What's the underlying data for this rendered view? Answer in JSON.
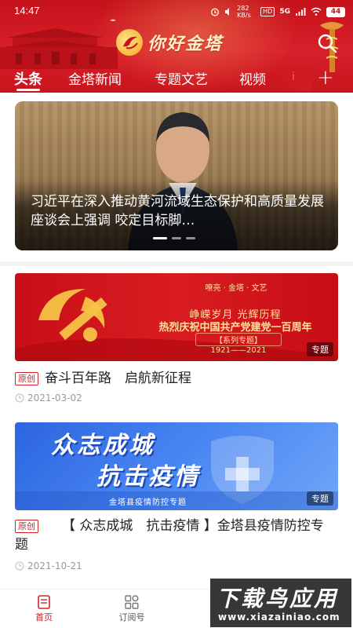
{
  "status_bar": {
    "time": "14:47",
    "speed": "282 KB/s",
    "hd": "HD",
    "network": "5G",
    "battery": "44"
  },
  "header": {
    "app_name": "你好金塔",
    "icons": {
      "logo": "jinta-logo-icon",
      "search": "search-icon",
      "add": "plus-icon"
    },
    "colors": {
      "primary": "#d0242a",
      "gold": "#ffe39c"
    }
  },
  "tabs": [
    {
      "label": "头条",
      "active": true
    },
    {
      "label": "金塔新闻",
      "active": false
    },
    {
      "label": "专题文艺",
      "active": false
    },
    {
      "label": "视频",
      "active": false
    },
    {
      "label": "i",
      "active": false
    }
  ],
  "tab_add_label": "+",
  "hero": {
    "title": "习近平在深入推动黄河流域生态保护和高质量发展座谈会上强调 咬定目标脚…",
    "slide_index": 1,
    "slide_count": 3
  },
  "articles": [
    {
      "banner": {
        "small_top": "嘹亮 · 金塔 · 文艺",
        "line1": "峥嵘岁月  光辉历程",
        "line2": "热烈庆祝中国共产党建党一百周年",
        "line3": "【系列专题】",
        "line4": "1921——2021",
        "tag": "专题"
      },
      "badge": "原创",
      "title": "奋斗百年路　启航新征程",
      "date": "2021-03-02"
    },
    {
      "banner": {
        "line1": "众志成城",
        "line2": "抗击疫情",
        "sub": "金塔县疫情防控专题",
        "tag": "专题"
      },
      "badge": "原创",
      "title": "【 众志成城　抗击疫情 】金塔县疫情防控专题",
      "date": "2021-10-21"
    }
  ],
  "bottom_nav": [
    {
      "label": "首页",
      "icon": "home-icon",
      "active": true
    },
    {
      "label": "订阅号",
      "icon": "grid-icon",
      "active": false
    }
  ],
  "watermark": {
    "big": "下载鸟应用",
    "small": "www.xiazainiao.com"
  }
}
